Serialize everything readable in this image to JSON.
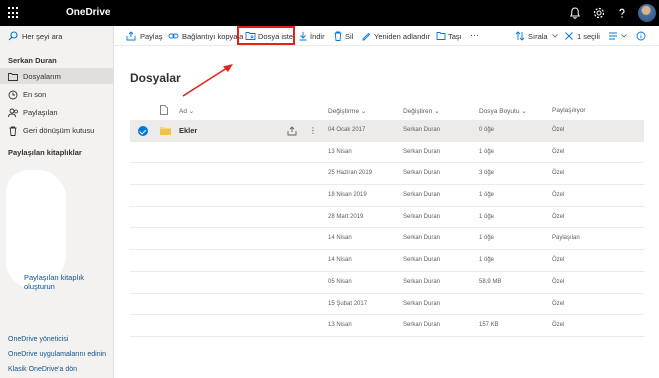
{
  "header": {
    "app_name": "OneDrive"
  },
  "search": {
    "placeholder": "Her şeyi ara"
  },
  "sidebar": {
    "user": "Serkan Duran",
    "items": [
      {
        "label": "Dosyalarım",
        "icon": "folder-icon",
        "active": true
      },
      {
        "label": "En son",
        "icon": "clock-icon"
      },
      {
        "label": "Paylaşılan",
        "icon": "people-icon"
      },
      {
        "label": "Geri dönüşüm kutusu",
        "icon": "recycle-bin-icon"
      }
    ],
    "shared_libraries_heading": "Paylaşılan kitaplıklar",
    "create_library": "Paylaşılan kitaplık oluşturun",
    "footer_links": [
      "OneDrive yöneticisi",
      "OneDrive uygulamalarını edinin",
      "Klasik OneDrive'a dön"
    ]
  },
  "toolbar": {
    "share": "Paylaş",
    "copy_link": "Bağlantıyı kopyala",
    "request_files": "Dosya iste",
    "download": "İndir",
    "delete": "Sil",
    "rename": "Yeniden adlandır",
    "move": "Taşı",
    "more": "···",
    "sort": "Sırala",
    "selected": "1 seçili"
  },
  "main": {
    "title": "Dosyalar",
    "columns": {
      "name": "Ad",
      "modified": "Değiştirme",
      "modified_by": "Değiştiren",
      "size": "Dosya Boyutu",
      "sharing": "Paylaşılıyor"
    },
    "rows": [
      {
        "name": "Ekler",
        "modified": "04 Ocak 2017",
        "modified_by": "Serkan Duran",
        "size": "0 öğe",
        "sharing": "Özel"
      },
      {
        "name": "",
        "modified": "13 Nisan",
        "modified_by": "Serkan Duran",
        "size": "1 öğe",
        "sharing": "Özel"
      },
      {
        "name": "",
        "modified": "25 Haziran 2019",
        "modified_by": "Serkan Duran",
        "size": "3 öğe",
        "sharing": "Özel"
      },
      {
        "name": "",
        "modified": "18 Nisan 2019",
        "modified_by": "Serkan Duran",
        "size": "1 öğe",
        "sharing": "Özel"
      },
      {
        "name": "",
        "modified": "28 Mart 2019",
        "modified_by": "Serkan Duran",
        "size": "1 öğe",
        "sharing": "Özel"
      },
      {
        "name": "",
        "modified": "14 Nisan",
        "modified_by": "Serkan Duran",
        "size": "1 öğe",
        "sharing": "Paylaşılan"
      },
      {
        "name": "",
        "modified": "14 Nisan",
        "modified_by": "Serkan Duran",
        "size": "1 öğe",
        "sharing": "Özel"
      },
      {
        "name": "",
        "modified": "05 Nisan",
        "modified_by": "Serkan Duran",
        "size": "58,9 MB",
        "sharing": "Özel"
      },
      {
        "name": "",
        "modified": "15 Şubat 2017",
        "modified_by": "Serkan Duran",
        "size": "",
        "sharing": "Özel"
      },
      {
        "name": "",
        "modified": "13 Nisan",
        "modified_by": "Serkan Duran",
        "size": "157 KB",
        "sharing": "Özel"
      }
    ]
  },
  "colors": {
    "accent": "#0078d4",
    "highlight_box": "#e0221c",
    "header_bg": "#000000",
    "folder": "#f8d775"
  }
}
